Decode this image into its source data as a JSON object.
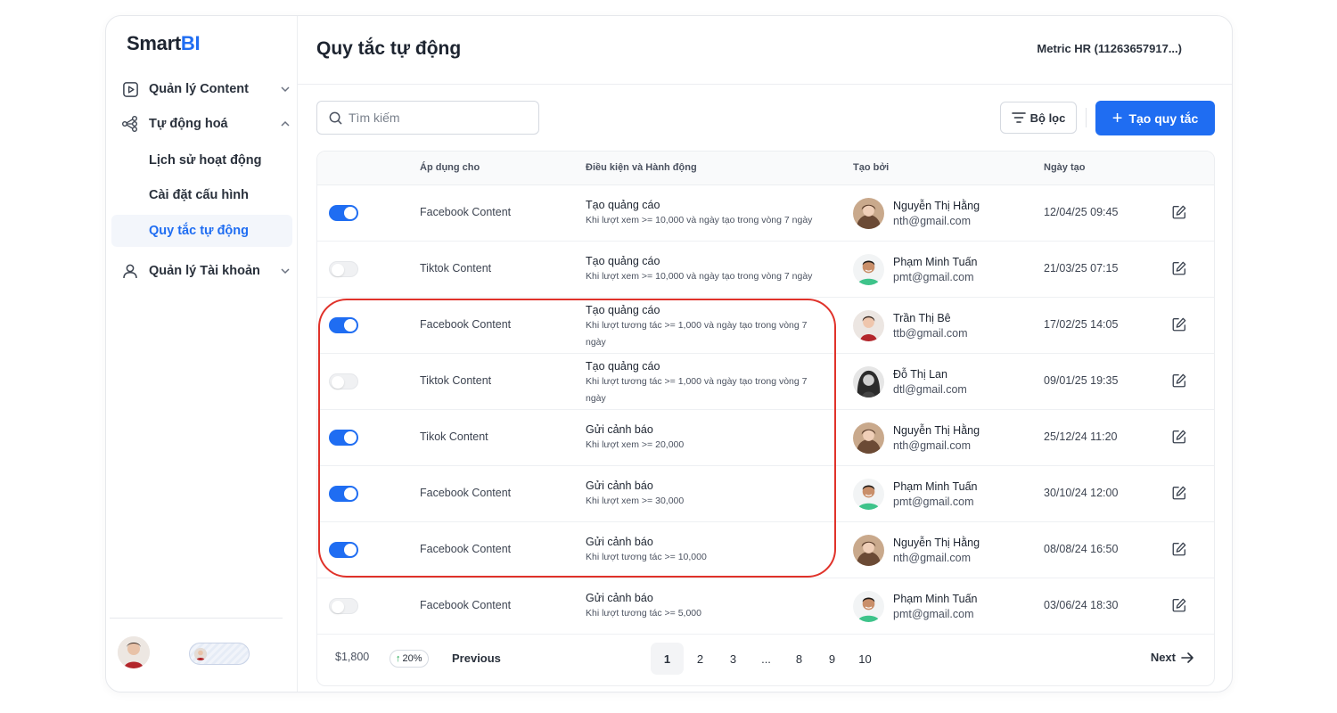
{
  "app": {
    "logo_main": "Smart",
    "logo_accent": "BI",
    "workspace": "Metric HR (11263657917...)",
    "page_title": "Quy tắc tự động"
  },
  "sidebar": {
    "content_menu": "Quản lý Content",
    "automation_menu": "Tự động hoá",
    "sub_items": [
      "Lịch sử hoạt động",
      "Cài đặt cấu hình",
      "Quy tắc tự động"
    ],
    "account_menu": "Quản lý Tài khoản"
  },
  "toolbar": {
    "search_placeholder": "Tìm kiếm",
    "filter_label": "Bộ lọc",
    "create_label": "Tạo quy tắc"
  },
  "table": {
    "headers": {
      "apply": "Áp dụng cho",
      "condition": "Điều kiện và Hành động",
      "creator": "Tạo bởi",
      "date": "Ngày tạo"
    },
    "rows": [
      {
        "enabled": true,
        "apply": "Facebook Content",
        "action": "Tạo quảng cáo",
        "condition": "Khi lượt xem >= 10,000 và ngày tạo trong vòng 7 ngày",
        "name": "Nguyễn Thị Hằng",
        "email": "nth@gmail.com",
        "date": "12/04/25 09:45",
        "avatar": "hang"
      },
      {
        "enabled": false,
        "apply": "Tiktok Content",
        "action": "Tạo quảng cáo",
        "condition": "Khi lượt xem >= 10,000 và ngày tạo trong vòng 7 ngày",
        "name": "Phạm Minh Tuấn",
        "email": "pmt@gmail.com",
        "date": "21/03/25 07:15",
        "avatar": "tuan"
      },
      {
        "enabled": true,
        "apply": "Facebook Content",
        "action": "Tạo quảng cáo",
        "condition": "Khi lượt tương tác >= 1,000 và ngày tạo trong vòng 7 ngày",
        "name": "Trần Thị Bê",
        "email": "ttb@gmail.com",
        "date": "17/02/25 14:05",
        "avatar": "be"
      },
      {
        "enabled": false,
        "apply": "Tiktok Content",
        "action": "Tạo quảng cáo",
        "condition": "Khi lượt tương tác >= 1,000 và ngày tạo trong vòng 7 ngày",
        "name": "Đỗ Thị Lan",
        "email": "dtl@gmail.com",
        "date": "09/01/25 19:35",
        "avatar": "lan"
      },
      {
        "enabled": true,
        "apply": "Tikok Content",
        "action": "Gửi cảnh báo",
        "condition": "Khi lượt xem >= 20,000",
        "name": "Nguyễn Thị Hằng",
        "email": "nth@gmail.com",
        "date": "25/12/24 11:20",
        "avatar": "hang"
      },
      {
        "enabled": true,
        "apply": "Facebook Content",
        "action": "Gửi cảnh báo",
        "condition": "Khi lượt xem >= 30,000",
        "name": "Phạm Minh Tuấn",
        "email": "pmt@gmail.com",
        "date": "30/10/24 12:00",
        "avatar": "tuan"
      },
      {
        "enabled": true,
        "apply": "Facebook Content",
        "action": "Gửi cảnh báo",
        "condition": "Khi lượt tương tác >= 10,000",
        "name": "Nguyễn Thị Hằng",
        "email": "nth@gmail.com",
        "date": "08/08/24 16:50",
        "avatar": "hang"
      },
      {
        "enabled": false,
        "apply": "Facebook Content",
        "action": "Gửi cảnh báo",
        "condition": "Khi lượt tương tác >= 5,000",
        "name": "Phạm Minh Tuấn",
        "email": "pmt@gmail.com",
        "date": "03/06/24 18:30",
        "avatar": "tuan"
      }
    ]
  },
  "pagination": {
    "price": "$1,800",
    "trend": "20%",
    "previous": "Previous",
    "pages": [
      "1",
      "2",
      "3",
      "...",
      "8",
      "9",
      "10"
    ],
    "current": "1",
    "next": "Next"
  },
  "colors": {
    "accent": "#1f6df2",
    "highlight": "#e0322a"
  }
}
